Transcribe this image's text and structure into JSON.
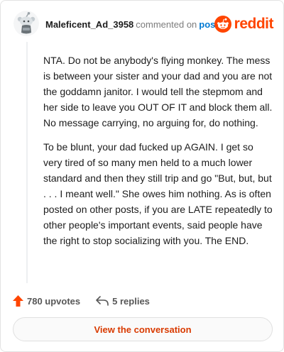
{
  "comment": {
    "username": "Maleficent_Ad_3958",
    "action_text": "commented on",
    "post_link": "post",
    "paragraphs": [
      "NTA. Do not be anybody's flying monkey. The mess is between your sister and your dad and you are not the goddamn janitor. I would tell the stepmom and her side to leave you OUT OF IT and block them all. No message carrying, no arguing for, do nothing.",
      "To be blunt, your dad fucked up AGAIN. I get so very tired of so many men held to a much lower standard and then they still trip and go \"But, but, but . . . I meant well.\" She owes him nothing. As is often posted on other posts, if you are LATE repeatedly to other people's important events, said people have the right to stop socializing with you. The END."
    ]
  },
  "brand": {
    "wordmark": "reddit",
    "color": "#ff4500"
  },
  "actions": {
    "upvotes": "780 upvotes",
    "replies": "5 replies"
  },
  "footer": {
    "view_button": "View the conversation"
  },
  "icons": {
    "avatar": "snoo-avatar-icon",
    "logo": "reddit-logo-icon",
    "upvote": "upvote-arrow-icon",
    "reply": "reply-arrow-icon"
  }
}
